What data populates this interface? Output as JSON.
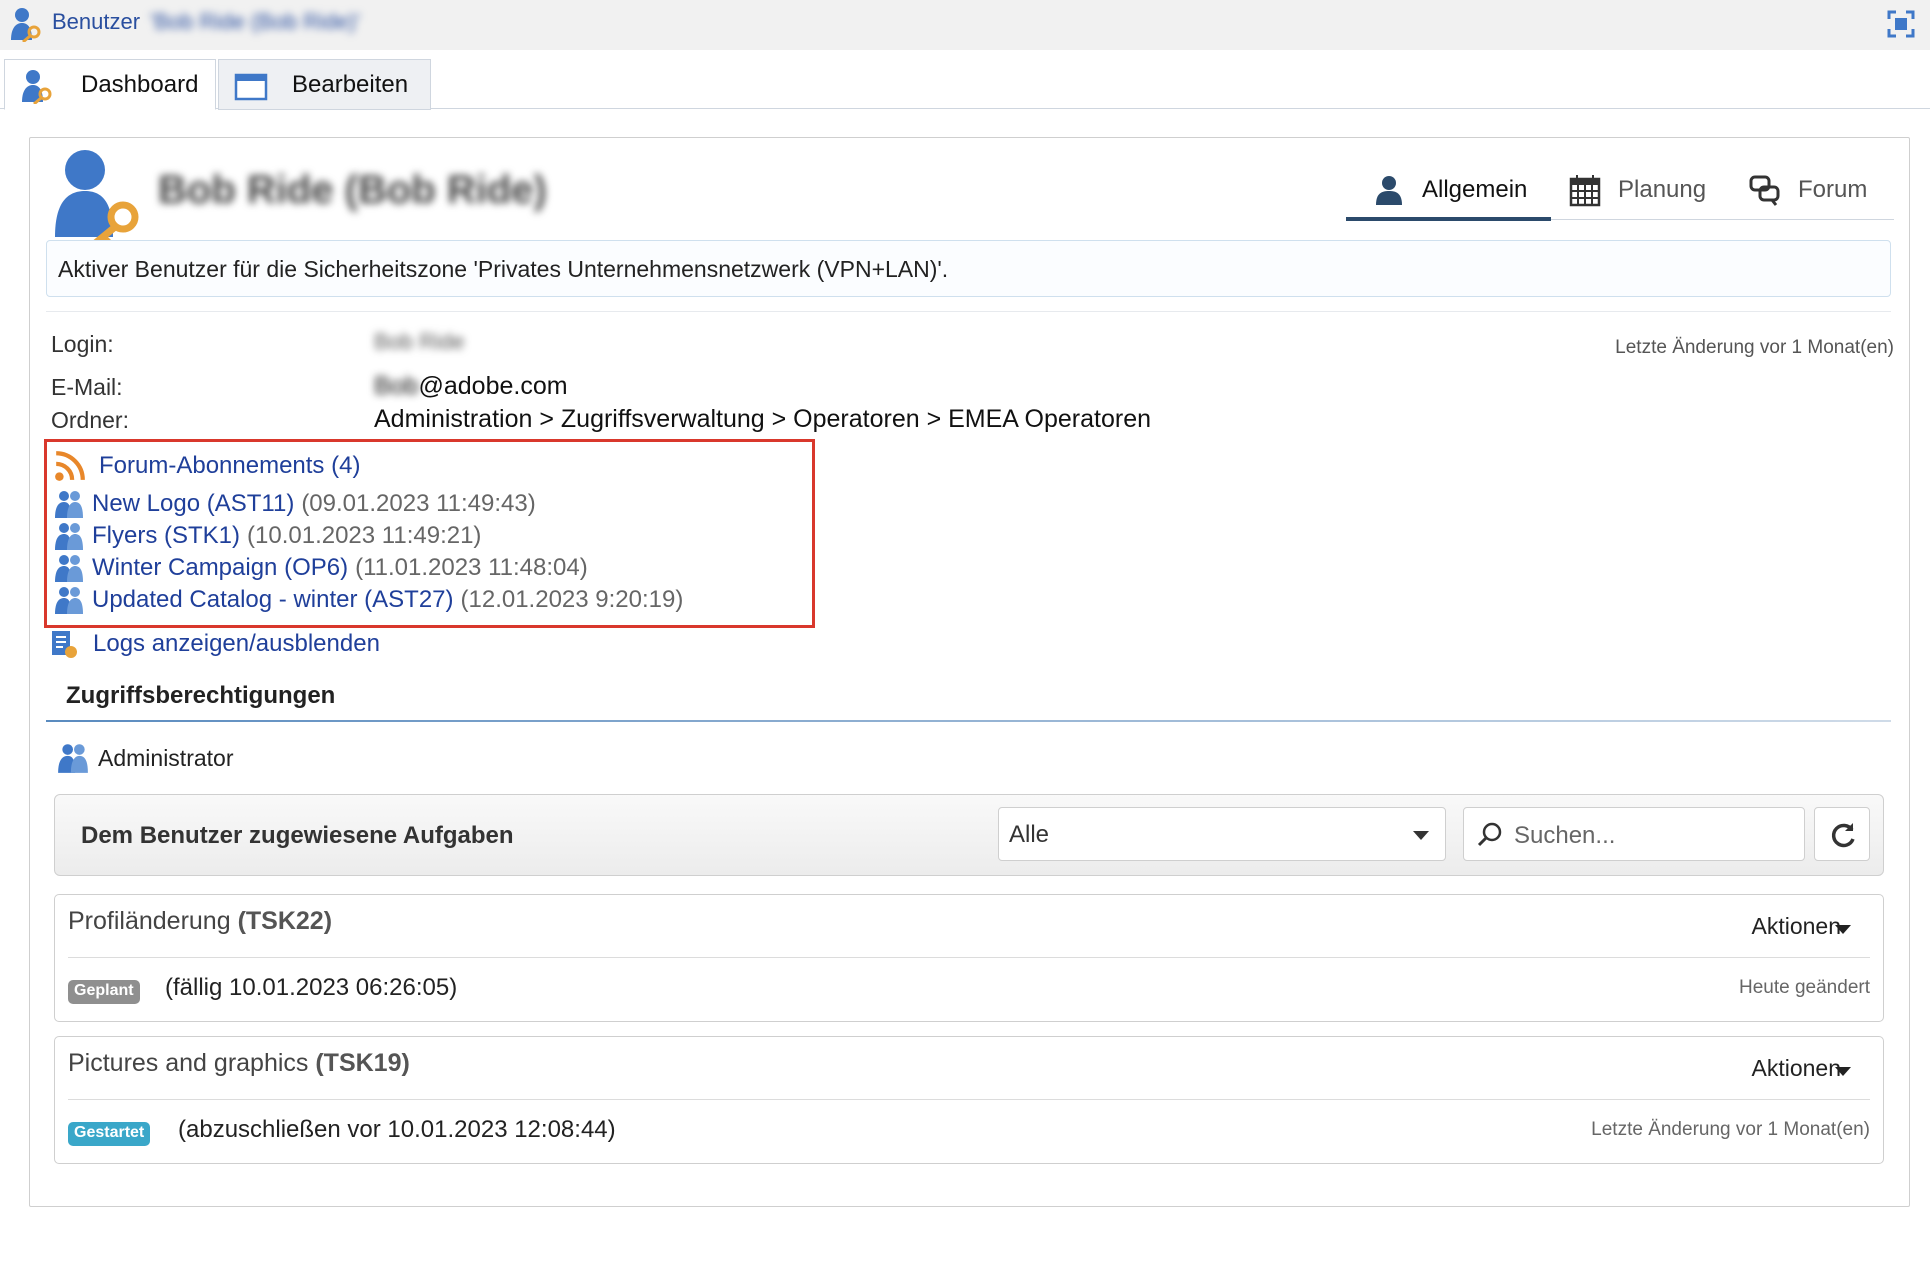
{
  "window": {
    "title_label": "Benutzer",
    "title_name": "'Bob Ride (Bob Ride)'"
  },
  "tabs": [
    {
      "label": "Dashboard"
    },
    {
      "label": "Bearbeiten"
    }
  ],
  "header": {
    "user_name": "Bob Ride (Bob Ride)",
    "view_tabs": [
      {
        "label": "Allgemein",
        "icon": "person-icon"
      },
      {
        "label": "Planung",
        "icon": "calendar-icon"
      },
      {
        "label": "Forum",
        "icon": "forum-icon"
      }
    ]
  },
  "info_message": "Aktiver Benutzer für die Sicherheitszone 'Privates Unternehmensnetzwerk (VPN+LAN)'.",
  "details": {
    "login_label": "Login:",
    "login_value": "Bob Ride",
    "email_label": "E-Mail:",
    "email_user": "Bob",
    "email_domain": "@adobe.com",
    "folder_label": "Ordner:",
    "folder_value": "Administration > Zugriffsverwaltung > Operatoren > EMEA Operatoren",
    "last_change": "Letzte Änderung vor 1 Monat(en)"
  },
  "forum": {
    "header": "Forum-Abonnements (4)",
    "items": [
      {
        "name": "New Logo (AST11)",
        "date": "(09.01.2023 11:49:43)"
      },
      {
        "name": "Flyers (STK1)",
        "date": "(10.01.2023 11:49:21)"
      },
      {
        "name": "Winter Campaign (OP6)",
        "date": "(11.01.2023 11:48:04)"
      },
      {
        "name": "Updated Catalog - winter (AST27)",
        "date": "(12.01.2023 9:20:19)"
      }
    ]
  },
  "logs_link": "Logs anzeigen/ausblenden",
  "access": {
    "title": "Zugriffsberechtigungen",
    "role": "Administrator"
  },
  "tasks": {
    "toolbar_label": "Dem Benutzer zugewiesene Aufgaben",
    "filter_value": "Alle",
    "search_placeholder": "Suchen...",
    "items": [
      {
        "title": "Profiländerung",
        "code": "(TSK22)",
        "actions": "Aktionen",
        "status": "Geplant",
        "status_color": "#8f8f8f",
        "detail": "(fällig 10.01.2023 06:26:05)",
        "changed": "Heute geändert"
      },
      {
        "title": "Pictures and graphics",
        "code": "(TSK19)",
        "actions": "Aktionen",
        "status": "Gestartet",
        "status_color": "#3aa7c9",
        "detail": "(abzuschließen vor 10.01.2023 12:08:44)",
        "changed": "Letzte Änderung vor 1 Monat(en)"
      }
    ]
  },
  "colors": {
    "link": "#1f3f9a",
    "highlight_border": "#d9382c",
    "accent": "#2b4a6b"
  }
}
